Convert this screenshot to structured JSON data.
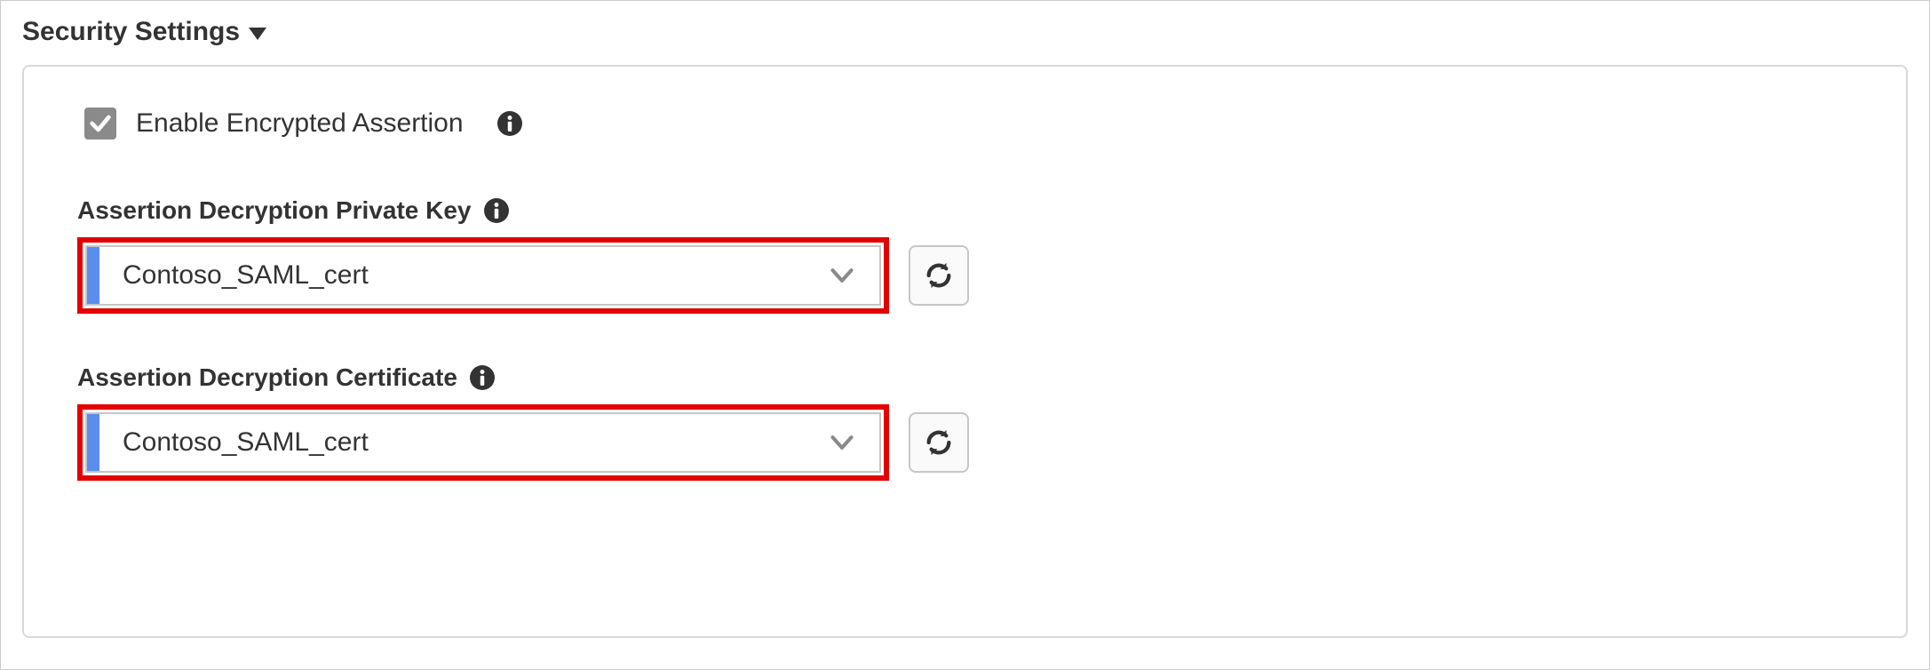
{
  "section": {
    "title": "Security Settings"
  },
  "enable_encrypted": {
    "label": "Enable Encrypted Assertion",
    "checked": true
  },
  "fields": {
    "private_key": {
      "label": "Assertion Decryption Private Key",
      "value": "Contoso_SAML_cert"
    },
    "certificate": {
      "label": "Assertion Decryption Certificate",
      "value": "Contoso_SAML_cert"
    }
  }
}
